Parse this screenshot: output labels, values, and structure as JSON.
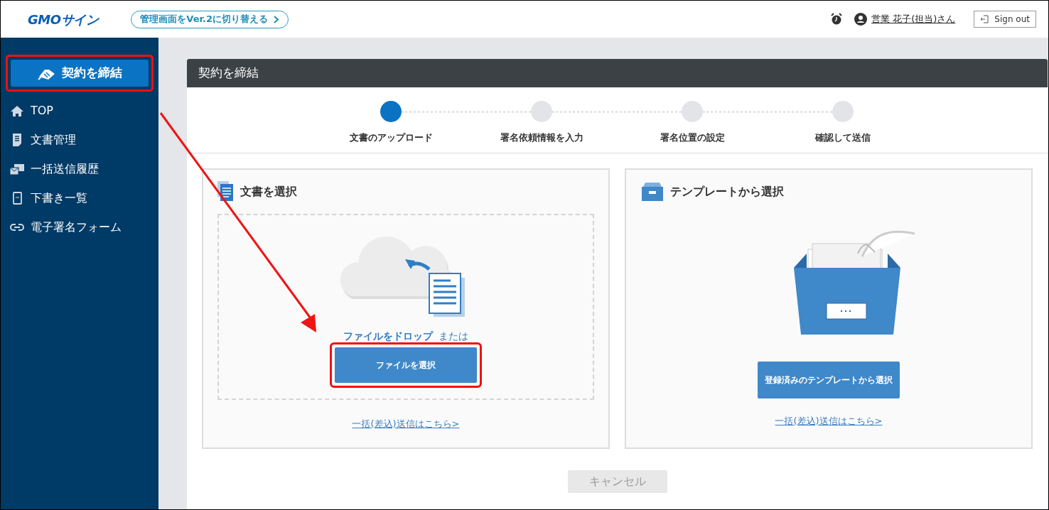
{
  "header": {
    "logo": "GMOサイン",
    "switch_link": "管理画面をVer.2に切り替える",
    "user": "営業 花子(担当)さん",
    "sign_out": "Sign out"
  },
  "sidebar": {
    "primary_button": {
      "label": "契約を締結",
      "highlighted": true
    },
    "items": [
      {
        "label": "TOP",
        "kind": "home"
      },
      {
        "label": "文書管理",
        "kind": "document"
      },
      {
        "label": "一括送信履歴",
        "kind": "bulk"
      },
      {
        "label": "下書き一覧",
        "kind": "draft"
      },
      {
        "label": "電子署名フォーム",
        "kind": "link"
      }
    ]
  },
  "panel": {
    "title": "契約を締結",
    "steps": [
      {
        "label": "文書のアップロード",
        "selected": true
      },
      {
        "label": "署名依頼情報を入力",
        "selected": false
      },
      {
        "label": "署名位置の設定",
        "selected": false
      },
      {
        "label": "確認して送信",
        "selected": false
      }
    ],
    "upload_card": {
      "title": "文書を選択",
      "drop_text": "ファイルをドロップ",
      "or_text": "または",
      "button": {
        "label": "ファイルを選択",
        "highlighted": true
      },
      "bulk_link": "一括(差込)送信はこちら>"
    },
    "template_card": {
      "title": "テンプレートから選択",
      "button": "登録済みのテンプレートから選択",
      "bulk_link": "一括(差込)送信はこちら>"
    },
    "cancel": "キャンセル"
  },
  "annotations": [
    {
      "kind": "arrow"
    }
  ]
}
